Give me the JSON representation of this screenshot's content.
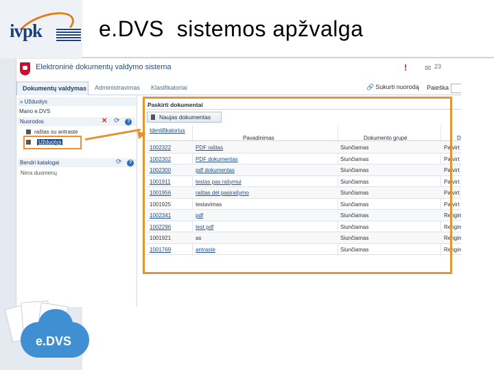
{
  "slide": {
    "title": "e.DVS  sistemos apžvalga",
    "logo_text": "ivpk"
  },
  "app": {
    "title": "Elektroninė dokumentų valdymo sistema",
    "message_count": "23",
    "menu": {
      "active": "Dokumentų valdymas",
      "items": [
        "Administravimas",
        "Klasifikatoriai"
      ],
      "quick_link": "Sukurti nuorodą",
      "search_label": "Paieška"
    },
    "left_panel": {
      "tasks": "» Užduotys",
      "my_edvs": "Mano e.DVS",
      "shortcuts": "Nuorodos",
      "shortcut_item": "raštas su antraste",
      "selected_item": "Užduotys",
      "common_catalogs": "Bendri katalogai",
      "no_data": "Nėra duomenų"
    },
    "main": {
      "panel_title": "Paskirti dokumentai",
      "new_doc_button": "Naujas dokumentas",
      "columns": [
        "Identifikatorius",
        "Pavadinimas",
        "Dokumento grupė",
        "D"
      ],
      "rows": [
        {
          "id": "1002322",
          "name": "PDF raštas",
          "group": "Siunčiamas",
          "extra": "Patvirt"
        },
        {
          "id": "1002302",
          "name": "PDF dokumentas",
          "group": "Siunčiamas",
          "extra": "Patvirt"
        },
        {
          "id": "1002300",
          "name": "pdf dokumentas",
          "group": "Siunčiamas",
          "extra": "Patvirt"
        },
        {
          "id": "1001911",
          "name": "testas pas rašymui",
          "group": "Siunčiamas",
          "extra": "Patvirt"
        },
        {
          "id": "1001956",
          "name": "raštas dėl pasirašymo",
          "group": "Siunčiamas",
          "extra": "Patvirt"
        },
        {
          "id": "1001925",
          "name": "testavimas",
          "group": "Siunčiamas",
          "extra": "Patvirt"
        },
        {
          "id": "1002341",
          "name": "pdf",
          "group": "Siunčiamas",
          "extra": "Rengim"
        },
        {
          "id": "1002296",
          "name": "test pdf",
          "group": "Siunčiamas",
          "extra": "Rengim"
        },
        {
          "id": "1001921",
          "name": "as",
          "group": "Siunčiamas",
          "extra": "Rengim"
        },
        {
          "id": "1001769",
          "name": "antraste",
          "group": "Siunčiamas",
          "extra": "Rengim"
        }
      ]
    }
  },
  "footer_logo": "e.DVS",
  "colors": {
    "accent_orange": "#e8912e",
    "brand_blue": "#1e4c8a",
    "cloud_blue": "#3f8fd2"
  }
}
